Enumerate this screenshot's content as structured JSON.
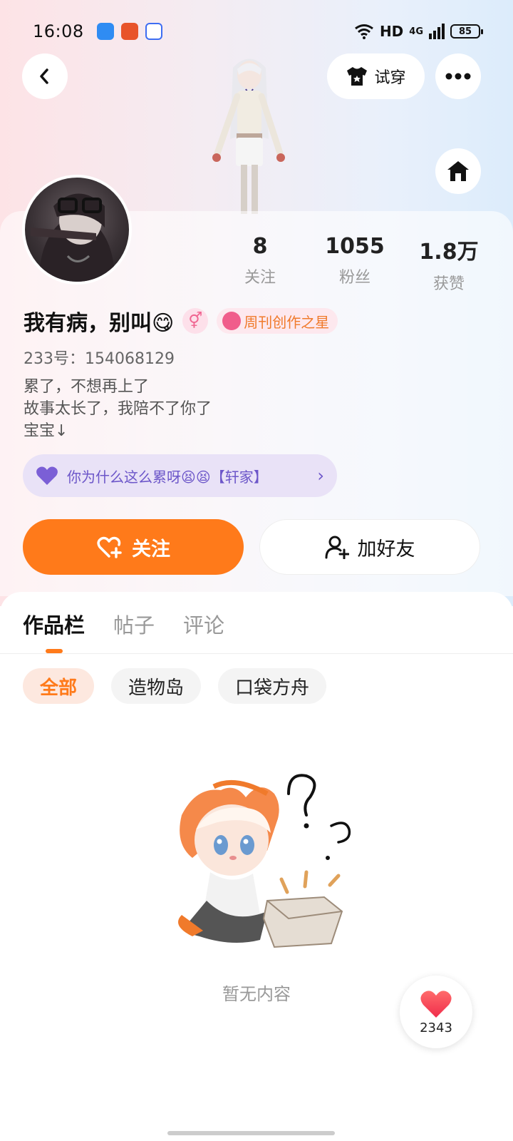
{
  "status_bar": {
    "time": "16:08",
    "network": "HD",
    "signal": "4G",
    "battery": "85"
  },
  "header": {
    "tryon_label": "试穿"
  },
  "profile": {
    "stats": [
      {
        "value": "8",
        "label": "关注"
      },
      {
        "value": "1055",
        "label": "粉丝"
      },
      {
        "value": "1.8万",
        "label": "获赞"
      }
    ],
    "username": "我有病，别叫😋",
    "gender_symbol": "⚥",
    "badge_label": "周刊创作之星",
    "uid": "233号：154068129",
    "bio_lines": [
      "累了，不想再上了",
      "故事太长了，我陪不了你了",
      "宝宝↓"
    ],
    "group_label": "你为什么这么累呀😫😫【轩家】"
  },
  "actions": {
    "follow_label": "关注",
    "add_friend_label": "加好友"
  },
  "tabs": [
    {
      "label": "作品栏",
      "active": true
    },
    {
      "label": "帖子",
      "active": false
    },
    {
      "label": "评论",
      "active": false
    }
  ],
  "filters": [
    {
      "label": "全部",
      "active": true
    },
    {
      "label": "造物岛",
      "active": false
    },
    {
      "label": "口袋方舟",
      "active": false
    }
  ],
  "empty_state": {
    "text": "暂无内容"
  },
  "like_fab": {
    "count": "2343"
  },
  "colors": {
    "accent": "#ff7a1a",
    "group_pill_bg": "#e9e2f7",
    "group_pill_text": "#6c56c9"
  }
}
